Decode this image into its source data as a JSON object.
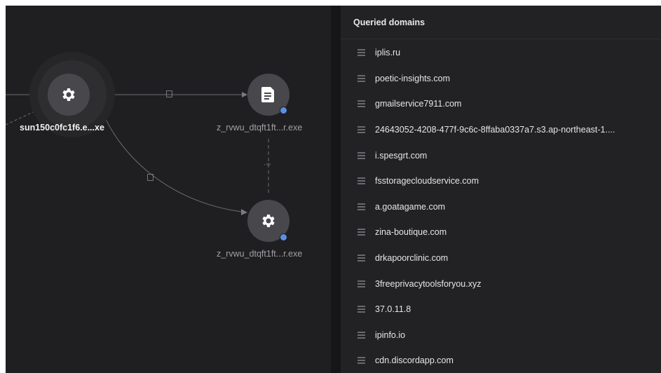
{
  "graph": {
    "nodes": [
      {
        "label": "sun150c0fc1f6.e...xe",
        "icon": "gear-icon"
      },
      {
        "label": "z_rvwu_dtqft1ft...r.exe",
        "icon": "document-icon"
      },
      {
        "label": "z_rvwu_dtqft1ft...r.exe",
        "icon": "gear-icon"
      }
    ]
  },
  "panel": {
    "title": "Queried domains",
    "domains": [
      "iplis.ru",
      "poetic-insights.com",
      "gmailservice7911.com",
      "24643052-4208-477f-9c6c-8ffaba0337a7.s3.ap-northeast-1....",
      "i.spesgrt.com",
      "fsstoragecloudservice.com",
      "a.goatagame.com",
      "zina-boutique.com",
      "drkapoorclinic.com",
      "3freeprivacytoolsforyou.xyz",
      "37.0.11.8",
      "ipinfo.io",
      "cdn.discordapp.com"
    ]
  },
  "colors": {
    "canvas": "#1f1f21",
    "panel": "#222224",
    "node": "#48484c",
    "badge": "#5b8fe6"
  }
}
